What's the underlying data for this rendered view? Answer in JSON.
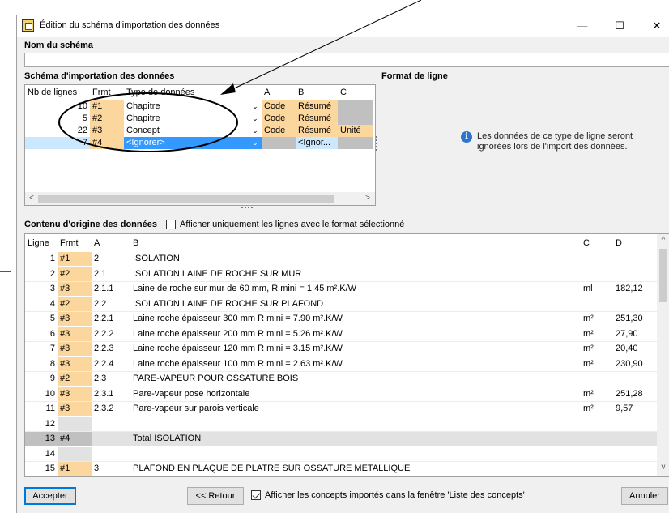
{
  "window": {
    "title": "Édition du schéma d'importation des données"
  },
  "labels": {
    "schema_name": "Nom du schéma",
    "schema_import": "Schéma d'importation des données",
    "line_format": "Format de ligne",
    "origin_content": "Contenu d'origine des données",
    "only_selected": "Afficher uniquement les lignes avec le format sélectionné",
    "info": "Les données de ce type de ligne seront ignorées lors de l'import des données."
  },
  "schema_table": {
    "headers": [
      "Nb de lignes",
      "Frmt",
      "Type de données",
      "A",
      "B",
      "C"
    ],
    "rows": [
      {
        "n": "10",
        "frmt": "#1",
        "type": "Chapitre",
        "a": "Code",
        "b": "Résumé",
        "c": ""
      },
      {
        "n": "5",
        "frmt": "#2",
        "type": "Chapitre",
        "a": "Code",
        "b": "Résumé",
        "c": ""
      },
      {
        "n": "22",
        "frmt": "#3",
        "type": "Concept",
        "a": "Code",
        "b": "Résumé",
        "c": "Unité"
      },
      {
        "n": "7",
        "frmt": "#4",
        "type": "<Ignorer>",
        "a": "",
        "b": "<Ignor...",
        "c": ""
      }
    ]
  },
  "data_table": {
    "headers": [
      "Ligne",
      "Frmt",
      "A",
      "B",
      "C",
      "D"
    ],
    "rows": [
      {
        "ligne": "1",
        "frmt": "#1",
        "a": "2",
        "b": "ISOLATION",
        "c": "",
        "d": ""
      },
      {
        "ligne": "2",
        "frmt": "#2",
        "a": "2.1",
        "b": "ISOLATION LAINE DE ROCHE SUR MUR",
        "c": "",
        "d": ""
      },
      {
        "ligne": "3",
        "frmt": "#3",
        "a": "2.1.1",
        "b": "Laine de roche sur mur de 60 mm, R mini = 1.45 m².K/W",
        "c": "ml",
        "d": "182,12"
      },
      {
        "ligne": "4",
        "frmt": "#2",
        "a": "2.2",
        "b": "ISOLATION LAINE DE ROCHE SUR PLAFOND",
        "c": "",
        "d": ""
      },
      {
        "ligne": "5",
        "frmt": "#3",
        "a": "2.2.1",
        "b": "Laine roche épaisseur 300 mm R mini = 7.90 m².K/W",
        "c": "m²",
        "d": "251,30"
      },
      {
        "ligne": "6",
        "frmt": "#3",
        "a": "2.2.2",
        "b": "Laine roche épaisseur 200 mm R mini = 5.26 m².K/W",
        "c": "m²",
        "d": "27,90"
      },
      {
        "ligne": "7",
        "frmt": "#3",
        "a": "2.2.3",
        "b": "Laine roche épaisseur 120 mm R mini = 3.15 m².K/W",
        "c": "m²",
        "d": "20,40"
      },
      {
        "ligne": "8",
        "frmt": "#3",
        "a": "2.2.4",
        "b": "Laine roche épaisseur 100 mm R mini = 2.63 m².K/W",
        "c": "m²",
        "d": "230,90"
      },
      {
        "ligne": "9",
        "frmt": "#2",
        "a": "2.3",
        "b": "PARE-VAPEUR POUR OSSATURE BOIS",
        "c": "",
        "d": ""
      },
      {
        "ligne": "10",
        "frmt": "#3",
        "a": "2.3.1",
        "b": "Pare-vapeur pose horizontale",
        "c": "m²",
        "d": "251,28"
      },
      {
        "ligne": "11",
        "frmt": "#3",
        "a": "2.3.2",
        "b": "Pare-vapeur sur parois verticale",
        "c": "m²",
        "d": "9,57"
      },
      {
        "ligne": "12",
        "frmt": "",
        "a": "",
        "b": "",
        "c": "",
        "d": ""
      },
      {
        "ligne": "13",
        "frmt": "#4",
        "a": "",
        "b": "Total ISOLATION",
        "c": "",
        "d": ""
      },
      {
        "ligne": "14",
        "frmt": "",
        "a": "",
        "b": "",
        "c": "",
        "d": ""
      },
      {
        "ligne": "15",
        "frmt": "#1",
        "a": "3",
        "b": "PLAFOND EN PLAQUE DE PLATRE SUR OSSATURE METALLIQUE",
        "c": "",
        "d": ""
      }
    ]
  },
  "buttons": {
    "accept": "Accepter",
    "back": "<< Retour",
    "cancel": "Annuler",
    "show_concepts": "Afficher les concepts importés dans la fenêtre 'Liste des concepts'"
  },
  "checkboxes": {
    "only_selected": false,
    "show_concepts": true
  },
  "colors": {
    "format_cell": "#fbd79d",
    "selection": "#cce8ff",
    "highlight": "#3399ff"
  }
}
